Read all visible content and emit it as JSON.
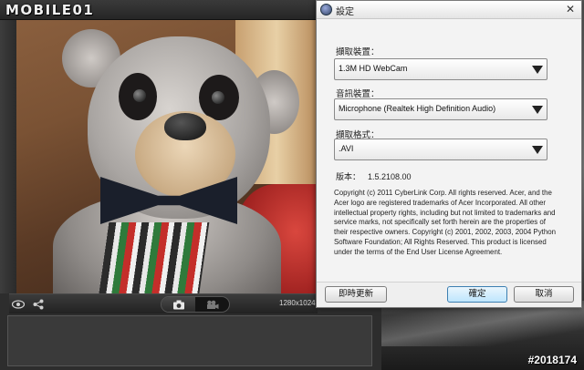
{
  "watermark": {
    "logo_text": "MOBILE01"
  },
  "image_id": "#2018174",
  "camera": {
    "resolution_label": "1280x1024"
  },
  "dialog": {
    "title": "設定",
    "close_glyph": "✕",
    "capture_device_label": "擷取裝置：",
    "capture_device_value": "1.3M HD WebCam",
    "audio_device_label": "音訊裝置：",
    "audio_device_value": "Microphone (Realtek High Definition Audio)",
    "capture_format_label": "擷取格式：",
    "capture_format_value": ".AVI",
    "version_label": "版本：",
    "version_value": "1.5.2108.00",
    "copyright_text": "Copyright (c) 2011 CyberLink Corp. All rights reserved. Acer, and the Acer logo are registered trademarks of Acer Incorporated. All other intellectual property rights, including but not limited to trademarks and service marks, not specifically set forth herein are the properties of their respective owners. Copyright (c) 2001, 2002, 2003, 2004 Python Software Foundation; All Rights Reserved. This product is licensed under the terms of the End User License Agreement.",
    "buttons": {
      "update": "即時更新",
      "ok": "確定",
      "cancel": "取消"
    }
  },
  "icons": {
    "eye": "eye-icon",
    "share": "share-icon",
    "camera": "camera-icon",
    "video": "video-camera-icon",
    "app": "app-icon",
    "close": "close-icon",
    "dropdown": "dropdown-arrow-icon"
  },
  "colors": {
    "dialog_bg": "#f3f3f3",
    "ok_button_border": "#3c7fb1",
    "app_dark": "#2d2d2d"
  }
}
